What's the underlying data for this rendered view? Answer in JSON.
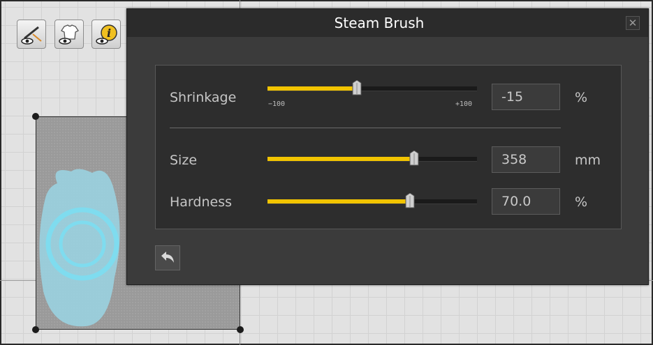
{
  "toolbar": {
    "buttons": [
      {
        "icon": "needle-eye-icon",
        "label": ""
      },
      {
        "icon": "shirt-eye-icon",
        "label": ""
      },
      {
        "icon": "info-eye-icon",
        "label": ""
      }
    ]
  },
  "dialog": {
    "title": "Steam Brush",
    "close_icon": "close-icon",
    "close_glyph": "✕",
    "shrinkage": {
      "label": "Shrinkage",
      "value": "-15",
      "unit": "%",
      "min_label": "−100",
      "max_label": "+100",
      "min": -100,
      "max": 100,
      "current": -15
    },
    "size": {
      "label": "Size",
      "value": "358",
      "unit": "mm",
      "fraction": 0.7
    },
    "hardness": {
      "label": "Hardness",
      "value": "70.0",
      "unit": "%",
      "fraction": 0.68
    },
    "back_icon": "undo-arrow-icon"
  },
  "colors": {
    "accent": "#f2c400",
    "brush_cursor": "#7fdcef",
    "steam_area": "#9ad2e0",
    "dialog_bg": "#3b3b3b",
    "panel_bg": "#2d2d2d"
  }
}
